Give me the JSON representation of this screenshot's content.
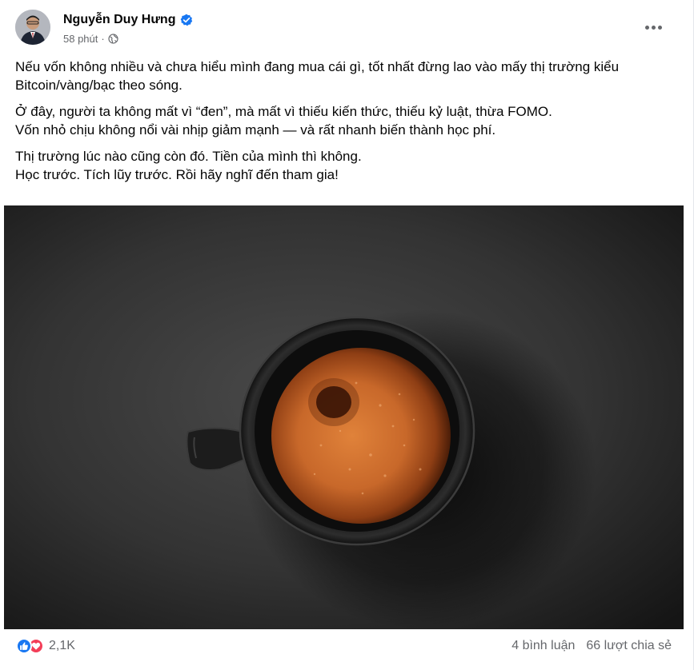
{
  "post": {
    "author": "Nguyễn Duy Hưng",
    "timestamp": "58 phút",
    "separator": "·",
    "paragraphs": [
      "Nếu vốn không nhiều và chưa hiểu mình đang mua cái gì, tốt nhất đừng lao vào mấy thị trường kiểu Bitcoin/vàng/bạc theo sóng.",
      "Ở đây, người ta không mất vì “đen”, mà mất vì thiếu kiến thức, thiếu kỷ luật, thừa FOMO.",
      "Vốn nhỏ chịu không nổi vài nhịp giảm mạnh — và rất nhanh biến thành học phí.",
      "Thị trường lúc nào cũng còn đó. Tiền của mình thì không.",
      "Học trước. Tích lũy trước. Rồi hãy nghĩ đến tham gia!"
    ],
    "image_subject": "espresso-cup-top-view"
  },
  "footer": {
    "reaction_count": "2,1K",
    "comments": "4 bình luận",
    "shares": "66 lượt chia sẻ"
  },
  "icons": {
    "verified": "verified-badge-icon",
    "privacy": "globe-icon",
    "more": "more-options-icon",
    "like": "like-reaction-icon",
    "love": "love-reaction-icon"
  },
  "colors": {
    "brand_blue": "#1877f2",
    "love_red": "#f33e58",
    "secondary_text": "#65676b"
  }
}
